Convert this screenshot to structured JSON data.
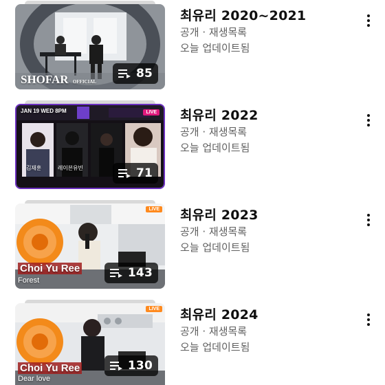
{
  "colors": {
    "text_primary": "#0f0f0f",
    "text_secondary": "#606060",
    "badge_bg": "#000000"
  },
  "playlists": [
    {
      "title": "최유리 2020~2021",
      "visibility": "공개 · 재생목록",
      "updated": "오늘 업데이트됨",
      "count": "85",
      "thumbnail_text": {
        "brand": "SHOFAR",
        "brand_small": "OFFICIAL"
      }
    },
    {
      "title": "최유리 2022",
      "visibility": "공개 · 재생목록",
      "updated": "오늘 업데이트됨",
      "count": "71",
      "thumbnail_text": {
        "date": "JAN 19 WED 8PM",
        "live": "LIVE",
        "name1": "김재훈",
        "name2": "레이븐유빈"
      }
    },
    {
      "title": "최유리 2023",
      "visibility": "공개 · 재생목록",
      "updated": "오늘 업데이트됨",
      "count": "143",
      "thumbnail_text": {
        "name": "Choi Yu Ree",
        "song": "Forest",
        "live": "LIVE"
      }
    },
    {
      "title": "최유리 2024",
      "visibility": "공개 · 재생목록",
      "updated": "오늘 업데이트됨",
      "count": "130",
      "thumbnail_text": {
        "name": "Choi Yu Ree",
        "song": "Dear love",
        "live": "LIVE"
      }
    }
  ],
  "icons": {
    "playlist": "playlist-icon",
    "more": "more-vert-icon"
  }
}
